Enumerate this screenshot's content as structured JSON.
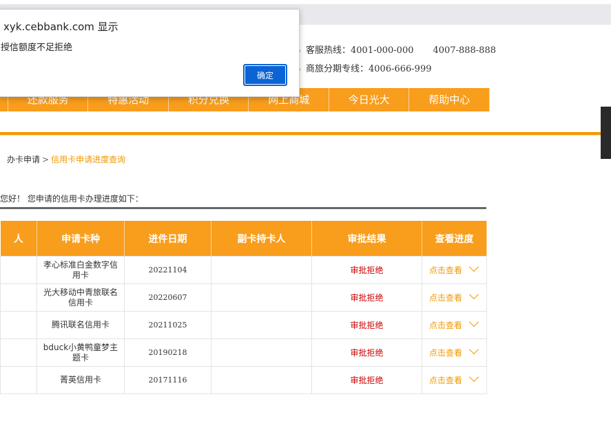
{
  "dialog": {
    "title": "xyk.cebbank.com 显示",
    "message": "授信额度不足拒绝",
    "ok_label": "确定"
  },
  "header": {
    "hotline_label": "客服热线：4001-000-000",
    "hotline_second": "4007-888-888",
    "travel_label": "商旅分期专线：4006-666-999"
  },
  "nav": {
    "items": [
      {
        "label": "还款服务"
      },
      {
        "label": "特惠活动"
      },
      {
        "label": "积分兑换"
      },
      {
        "label": "网上商城"
      },
      {
        "label": "今日光大"
      },
      {
        "label": "帮助中心"
      }
    ]
  },
  "breadcrumb": {
    "parent": "办卡申请",
    "separator": ">",
    "current": "信用卡申请进度查询"
  },
  "greeting": "您好！ 您申请的信用卡办理进度如下：",
  "table": {
    "headers": [
      "人",
      "申请卡种",
      "进件日期",
      "副卡持卡人",
      "审批结果",
      "查看进度"
    ],
    "rows": [
      {
        "card": "孝心标准白金数字信用卡",
        "date": "20221104",
        "supp": "",
        "result": "审批拒绝",
        "action": "点击查看"
      },
      {
        "card": "光大移动中青旅联名信用卡",
        "date": "20220607",
        "supp": "",
        "result": "审批拒绝",
        "action": "点击查看"
      },
      {
        "card": "腾讯联名信用卡",
        "date": "20211025",
        "supp": "",
        "result": "审批拒绝",
        "action": "点击查看"
      },
      {
        "card": "bduck小黄鸭童梦主题卡",
        "date": "20190218",
        "supp": "",
        "result": "审批拒绝",
        "action": "点击查看"
      },
      {
        "card": "菁英信用卡",
        "date": "20171116",
        "supp": "",
        "result": "审批拒绝",
        "action": "点击查看"
      }
    ]
  },
  "colors": {
    "accent": "#f89d1c",
    "reject": "#cc0000",
    "link": "#f39800",
    "dialog_button": "#0b63d6"
  }
}
